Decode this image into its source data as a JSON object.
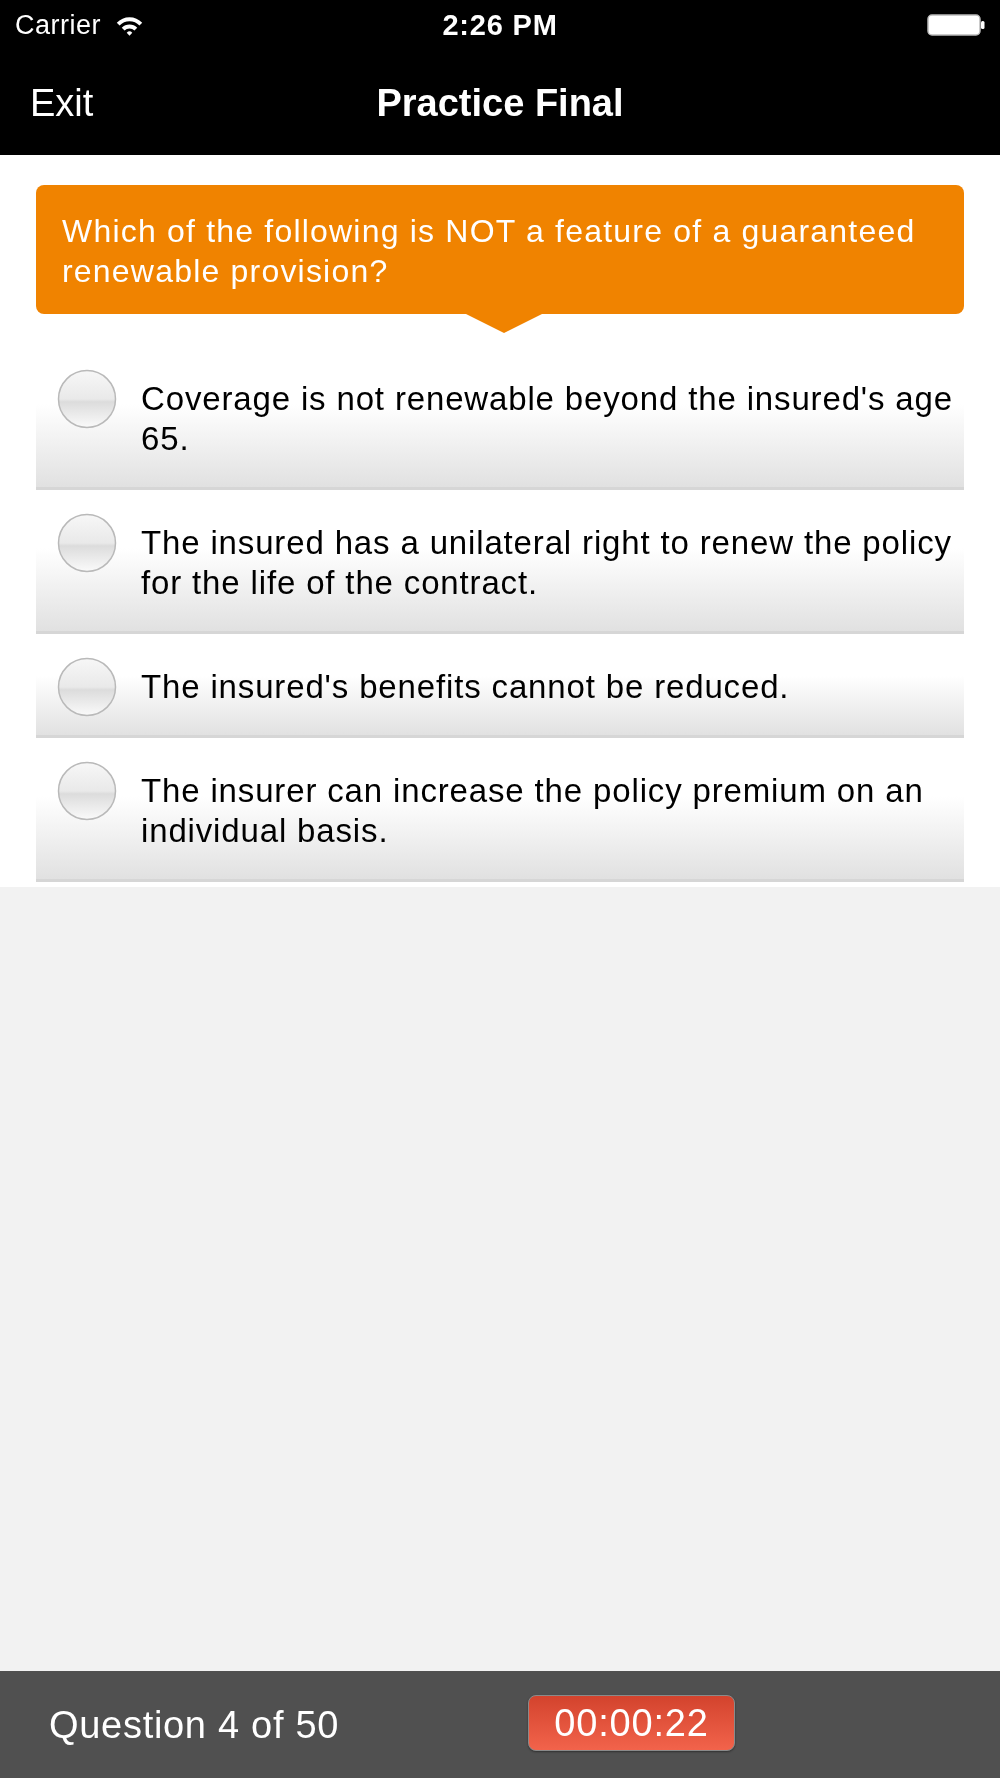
{
  "status_bar": {
    "carrier": "Carrier",
    "time": "2:26 PM"
  },
  "nav_bar": {
    "left_button": "Exit",
    "title": "Practice Final"
  },
  "question": {
    "text": "Which of the following is NOT a feature of a guaranteed renewable provision?"
  },
  "options": [
    {
      "text": "Coverage is not renewable beyond the insured's age 65.",
      "selected": false
    },
    {
      "text": "The insured has a unilateral right to renew the policy for the life of the contract.",
      "selected": false
    },
    {
      "text": "The insured's benefits cannot be reduced.",
      "selected": false
    },
    {
      "text": "The insurer can increase the policy premium on an individual basis.",
      "selected": false
    }
  ],
  "footer": {
    "progress": "Question 4 of 50",
    "timer": "00:00:22"
  }
}
